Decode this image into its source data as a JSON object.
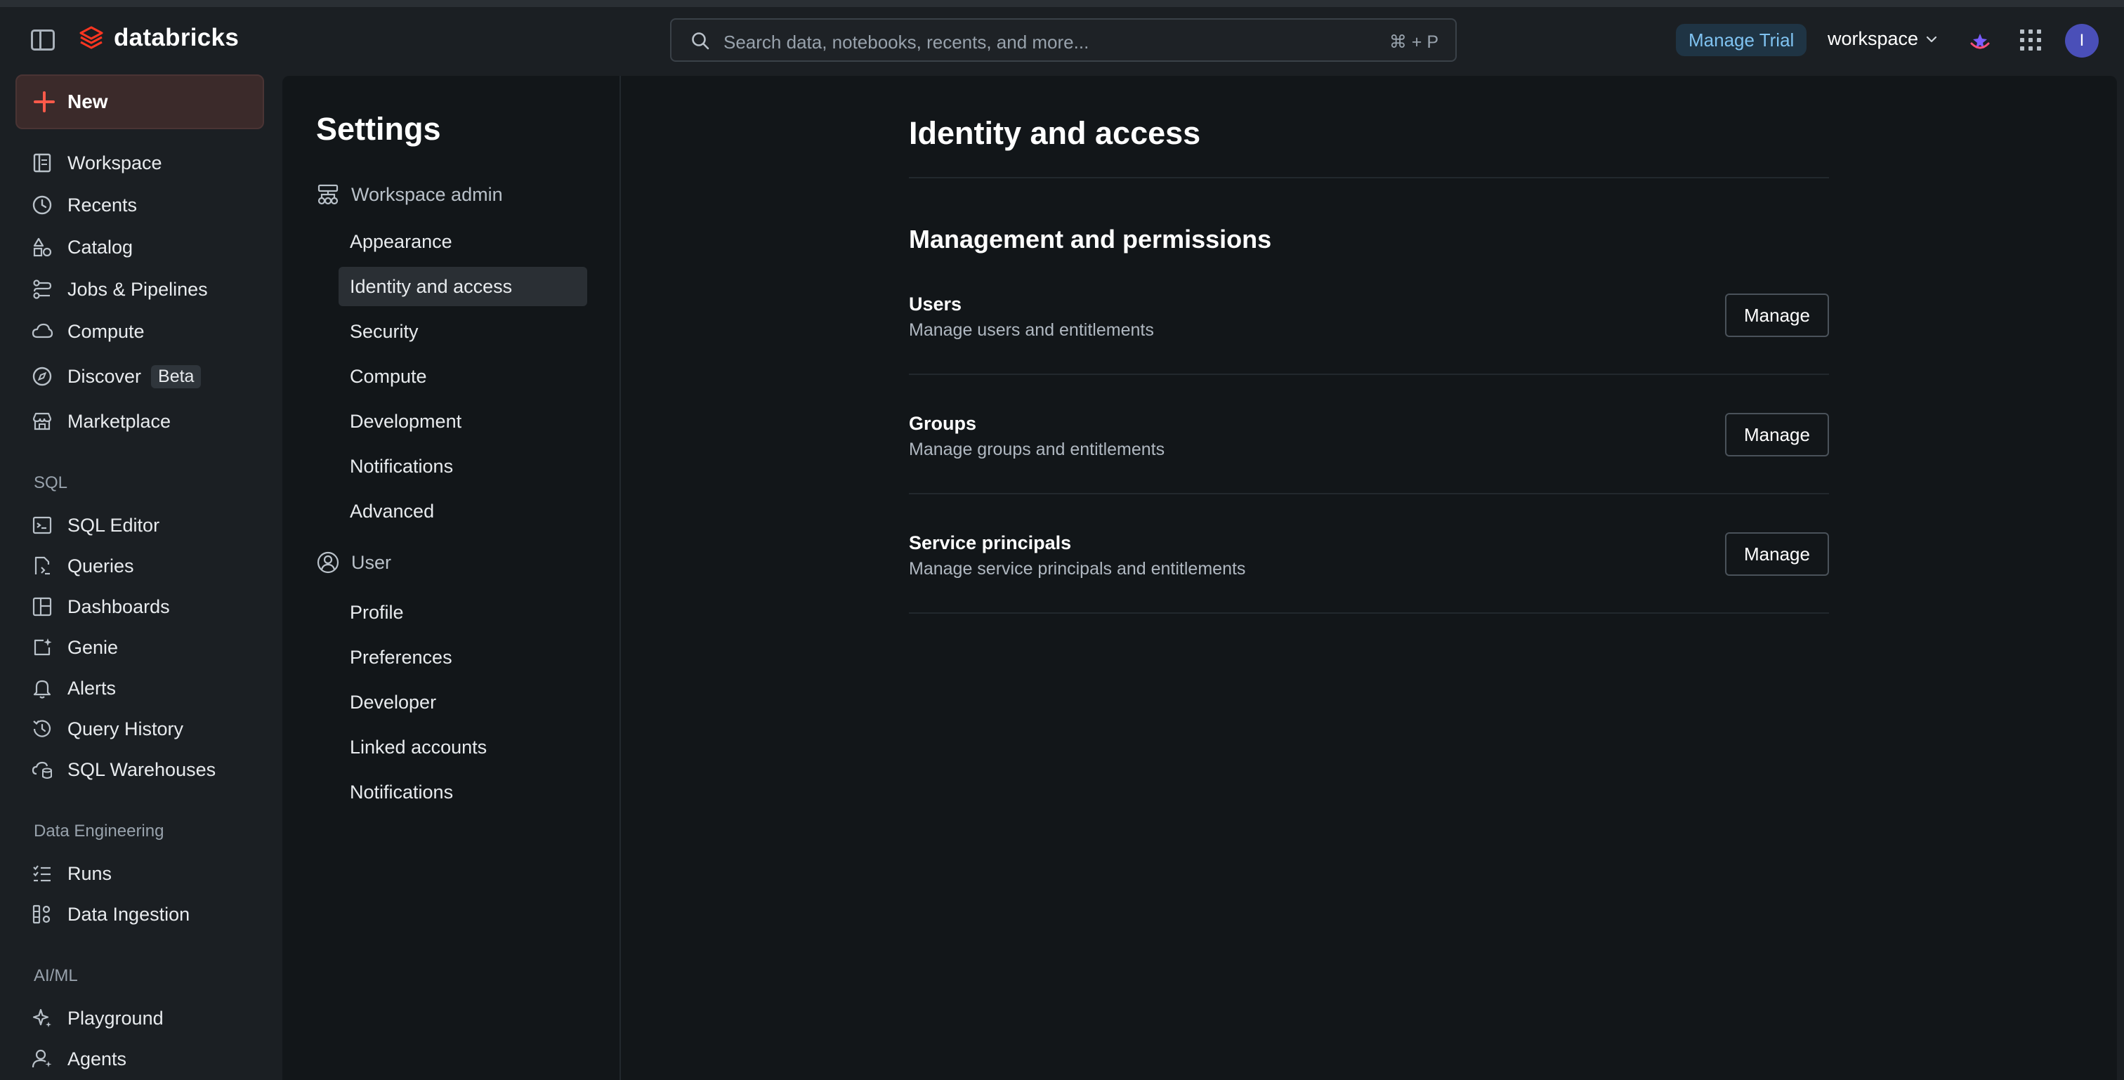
{
  "topbar": {
    "brand": "databricks",
    "search_placeholder": "Search data, notebooks, recents, and more...",
    "search_shortcut": "⌘ + P",
    "manage_trial": "Manage Trial",
    "workspace": "workspace",
    "avatar_initial": "I"
  },
  "leftnav": {
    "new_label": "New",
    "items": [
      {
        "label": "Workspace",
        "icon": "workspace-icon"
      },
      {
        "label": "Recents",
        "icon": "clock-icon"
      },
      {
        "label": "Catalog",
        "icon": "catalog-icon"
      },
      {
        "label": "Jobs & Pipelines",
        "icon": "workflow-icon"
      },
      {
        "label": "Compute",
        "icon": "cloud-icon"
      },
      {
        "label": "Discover",
        "icon": "compass-icon",
        "badge": "Beta"
      },
      {
        "label": "Marketplace",
        "icon": "store-icon"
      }
    ],
    "sql_section": "SQL",
    "sql_items": [
      {
        "label": "SQL Editor",
        "icon": "sql-editor-icon"
      },
      {
        "label": "Queries",
        "icon": "query-icon"
      },
      {
        "label": "Dashboards",
        "icon": "dashboard-icon"
      },
      {
        "label": "Genie",
        "icon": "genie-icon"
      },
      {
        "label": "Alerts",
        "icon": "bell-icon"
      },
      {
        "label": "Query History",
        "icon": "history-icon"
      },
      {
        "label": "SQL Warehouses",
        "icon": "warehouse-icon"
      }
    ],
    "de_section": "Data Engineering",
    "de_items": [
      {
        "label": "Runs",
        "icon": "runs-icon"
      },
      {
        "label": "Data Ingestion",
        "icon": "ingestion-icon"
      }
    ],
    "ml_section": "AI/ML",
    "ml_items": [
      {
        "label": "Playground",
        "icon": "sparkle-icon"
      },
      {
        "label": "Agents",
        "icon": "agents-icon"
      }
    ]
  },
  "settings": {
    "title": "Settings",
    "workspace_admin": "Workspace admin",
    "admin_items": [
      "Appearance",
      "Identity and access",
      "Security",
      "Compute",
      "Development",
      "Notifications",
      "Advanced"
    ],
    "active_item": "Identity and access",
    "user_group": "User",
    "user_items": [
      "Profile",
      "Preferences",
      "Developer",
      "Linked accounts",
      "Notifications"
    ]
  },
  "content": {
    "page_title": "Identity and access",
    "section_title": "Management and permissions",
    "rows": [
      {
        "title": "Users",
        "description": "Manage users and entitlements",
        "button": "Manage"
      },
      {
        "title": "Groups",
        "description": "Manage groups and entitlements",
        "button": "Manage"
      },
      {
        "title": "Service principals",
        "description": "Manage service principals and entitlements",
        "button": "Manage"
      }
    ]
  },
  "colors": {
    "background": "#1b1f23",
    "panel": "#121619",
    "brand_accent": "#ff5a4a",
    "trial_text": "#7fc2f0",
    "avatar": "#4a4fb8"
  }
}
